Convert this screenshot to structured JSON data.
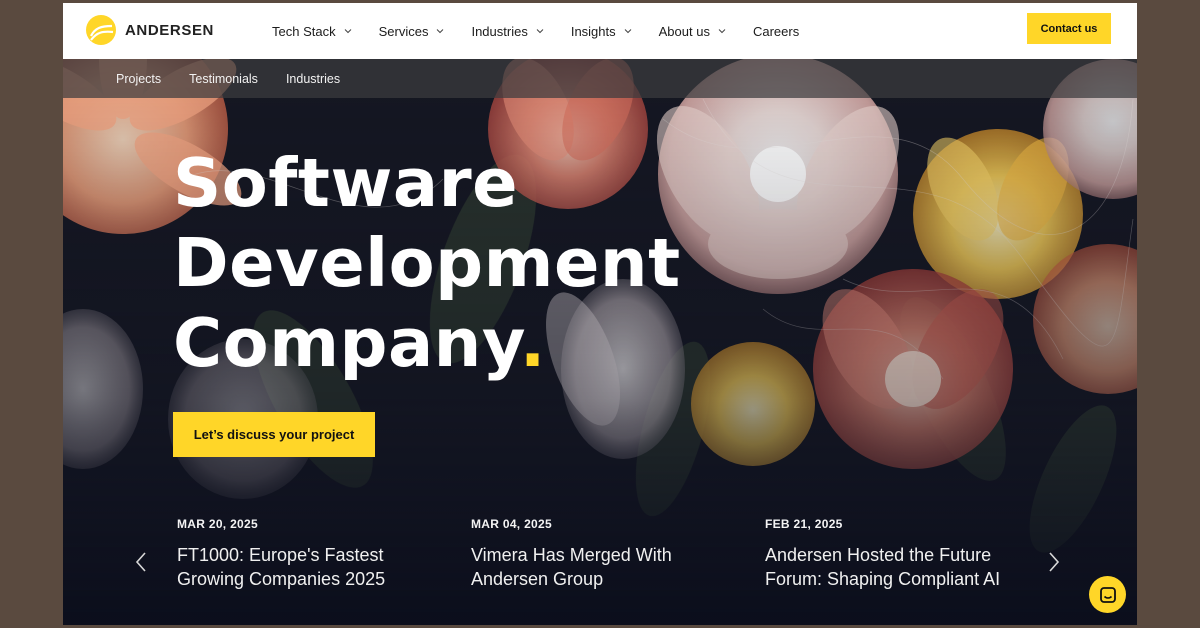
{
  "header": {
    "logo_text": "ANDERSEN",
    "nav": [
      {
        "label": "Tech Stack",
        "has_dropdown": true
      },
      {
        "label": "Services",
        "has_dropdown": true
      },
      {
        "label": "Industries",
        "has_dropdown": true
      },
      {
        "label": "Insights",
        "has_dropdown": true
      },
      {
        "label": "About us",
        "has_dropdown": true
      },
      {
        "label": "Careers",
        "has_dropdown": false
      }
    ],
    "contact_label": "Contact us"
  },
  "subnav": [
    "Projects",
    "Testimonials",
    "Industries"
  ],
  "hero": {
    "headline": [
      "Software",
      "Development",
      "Company"
    ],
    "headline_dot": ".",
    "cta_label": "Let’s discuss your project"
  },
  "news": [
    {
      "date": "MAR 20, 2025",
      "title": "FT1000: Europe's Fastest Growing Companies 2025"
    },
    {
      "date": "MAR 04, 2025",
      "title": "Vimera Has Merged With Andersen Group"
    },
    {
      "date": "FEB 21, 2025",
      "title": "Andersen Hosted the Future Forum: Shaping Compliant AI"
    }
  ],
  "icons": {
    "logo": "andersen-logo-icon",
    "prev": "chevron-left-icon",
    "next": "chevron-right-icon",
    "chat": "chat-icon",
    "dropdown": "chevron-down-icon"
  },
  "colors": {
    "accent": "#ffd628",
    "header_bg": "#ffffff",
    "page_bg": "#5a4a3f",
    "hero_bg": "#0f1220"
  }
}
